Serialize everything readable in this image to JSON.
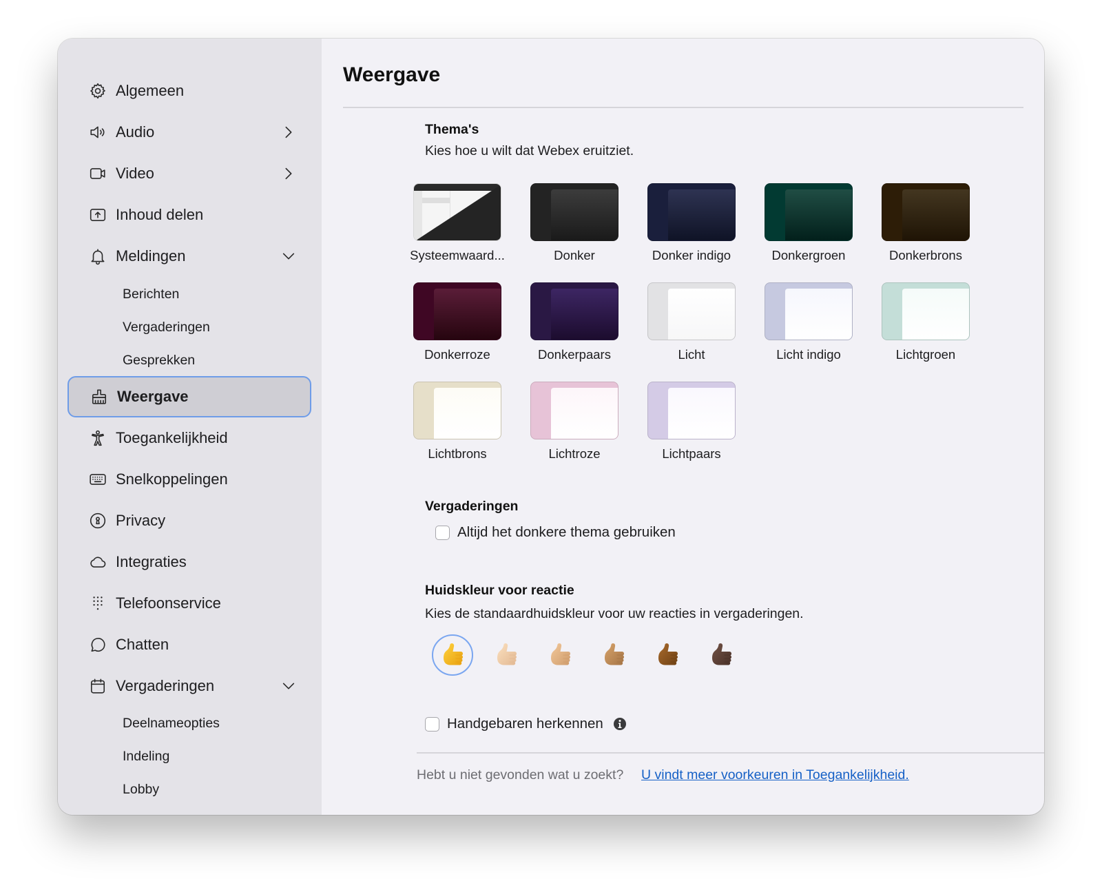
{
  "sidebar": {
    "items": [
      {
        "label": "Algemeen",
        "icon": "gear-icon"
      },
      {
        "label": "Audio",
        "icon": "speaker-icon",
        "chevron": "chevron-right"
      },
      {
        "label": "Video",
        "icon": "video-camera-icon",
        "chevron": "chevron-right"
      },
      {
        "label": "Inhoud delen",
        "icon": "share-screen-icon"
      },
      {
        "label": "Meldingen",
        "icon": "bell-icon",
        "chevron": "chevron-down",
        "children": [
          "Berichten",
          "Vergaderingen",
          "Gesprekken"
        ]
      },
      {
        "label": "Weergave",
        "icon": "brush-icon",
        "active": true
      },
      {
        "label": "Toegankelijkheid",
        "icon": "accessibility-icon"
      },
      {
        "label": "Snelkoppelingen",
        "icon": "keyboard-icon"
      },
      {
        "label": "Privacy",
        "icon": "privacy-lock-icon"
      },
      {
        "label": "Integraties",
        "icon": "cloud-icon"
      },
      {
        "label": "Telefoonservice",
        "icon": "dialpad-icon"
      },
      {
        "label": "Chatten",
        "icon": "chat-bubble-icon"
      },
      {
        "label": "Vergaderingen",
        "icon": "calendar-icon",
        "chevron": "chevron-down",
        "children": [
          "Deelnameopties",
          "Indeling",
          "Lobby"
        ]
      }
    ]
  },
  "main": {
    "title": "Weergave",
    "themes_section": {
      "title": "Thema's",
      "description": "Kies hoe u wilt dat Webex eruitziet.",
      "themes": [
        {
          "label": "Systeemwaard...",
          "style": "system"
        },
        {
          "label": "Donker",
          "side": "#232323",
          "panel_top": "#3c3c3c",
          "panel_bottom": "#1a1a1a"
        },
        {
          "label": "Donker indigo",
          "side": "#1a1f3c",
          "panel_top": "#2e3352",
          "panel_bottom": "#0f1326"
        },
        {
          "label": "Donkergroen",
          "side": "#023a32",
          "panel_top": "#204d44",
          "panel_bottom": "#02201b"
        },
        {
          "label": "Donkerbrons",
          "side": "#2d1d07",
          "panel_top": "#433620",
          "panel_bottom": "#1f1405"
        },
        {
          "label": "Donkerroze",
          "side": "#3f0724",
          "panel_top": "#5a1d38",
          "panel_bottom": "#26050f"
        },
        {
          "label": "Donkerpaars",
          "side": "#2a1844",
          "panel_top": "#3d2663",
          "panel_bottom": "#1c0c2e"
        },
        {
          "label": "Licht",
          "side": "#e2e2e4",
          "panel_top": "#ffffff",
          "panel_bottom": "#f7f7f8"
        },
        {
          "label": "Licht indigo",
          "side": "#c6c9e0",
          "panel_top": "#f6f7fd",
          "panel_bottom": "#ffffff"
        },
        {
          "label": "Lichtgroen",
          "side": "#c4ded8",
          "panel_top": "#f5fbf9",
          "panel_bottom": "#ffffff"
        },
        {
          "label": "Lichtbrons",
          "side": "#e6dfc9",
          "panel_top": "#fdfcf6",
          "panel_bottom": "#ffffff"
        },
        {
          "label": "Lichtroze",
          "side": "#e7c3d7",
          "panel_top": "#fdf6fa",
          "panel_bottom": "#ffffff"
        },
        {
          "label": "Lichtpaars",
          "side": "#d4cbe6",
          "panel_top": "#faf8fe",
          "panel_bottom": "#ffffff"
        }
      ]
    },
    "meetings_section": {
      "title": "Vergaderingen",
      "checkbox_label": "Altijd het donkere thema gebruiken",
      "checked": false
    },
    "skin_section": {
      "title": "Huidskleur voor reactie",
      "description": "Kies de standaardhuidskleur voor uw reacties in vergaderingen.",
      "selected_index": 0,
      "tones": [
        {
          "name": "default-yellow",
          "light": "#ffd23d",
          "dark": "#e8a010"
        },
        {
          "name": "light",
          "light": "#fbe0bf",
          "dark": "#e2b892"
        },
        {
          "name": "medium-light",
          "light": "#f2c89a",
          "dark": "#cf9c6c"
        },
        {
          "name": "medium",
          "light": "#d7a36b",
          "dark": "#a57445"
        },
        {
          "name": "medium-dark",
          "light": "#a86a2c",
          "dark": "#6f4114"
        },
        {
          "name": "dark",
          "light": "#725246",
          "dark": "#4a3128"
        }
      ]
    },
    "gestures": {
      "checkbox_label": "Handgebaren herkennen",
      "checked": false,
      "info_icon": "info-icon"
    },
    "footer": {
      "text": "Hebt u niet gevonden wat u zoekt?",
      "link": "U vindt meer voorkeuren in Toegankelijkheid."
    }
  }
}
